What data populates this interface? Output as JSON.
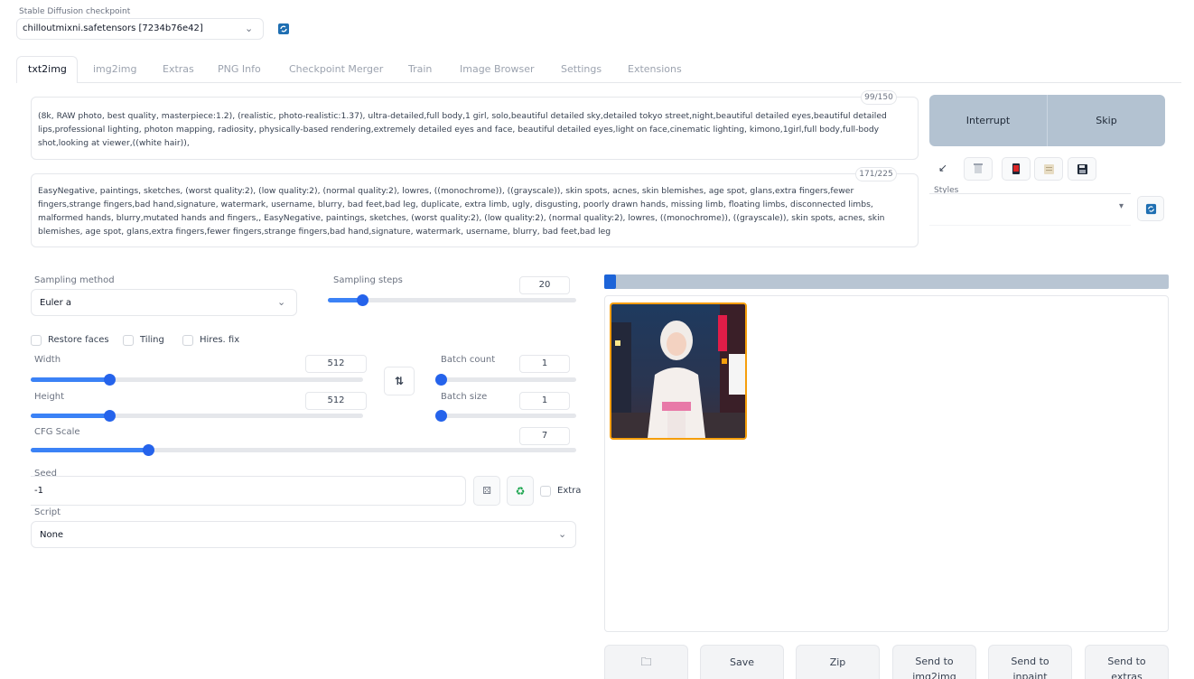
{
  "checkpoint": {
    "label": "Stable Diffusion checkpoint",
    "value": "chilloutmixni.safetensors [7234b76e42]"
  },
  "tabs": [
    "txt2img",
    "img2img",
    "Extras",
    "PNG Info",
    "Checkpoint Merger",
    "Train",
    "Image Browser",
    "Settings",
    "Extensions"
  ],
  "prompt": {
    "counter": "99/150",
    "text": "(8k, RAW photo, best quality, masterpiece:1.2), (realistic, photo-realistic:1.37), ultra-detailed,full body,1 girl, solo,beautiful detailed sky,detailed tokyo street,night,beautiful detailed eyes,beautiful detailed lips,professional lighting, photon mapping, radiosity, physically-based rendering,extremely detailed eyes and face, beautiful detailed eyes,light on face,cinematic lighting, kimono,1girl,full body,full-body shot,looking at viewer,((white hair)),"
  },
  "negative_prompt": {
    "counter": "171/225",
    "text": "EasyNegative, paintings, sketches, (worst quality:2), (low quality:2), (normal quality:2), lowres, ((monochrome)), ((grayscale)), skin spots, acnes, skin blemishes, age spot, glans,extra fingers,fewer fingers,strange fingers,bad hand,signature, watermark, username, blurry, bad feet,bad leg, duplicate, extra limb, ugly, disgusting, poorly drawn hands, missing limb, floating limbs, disconnected limbs, malformed hands, blurry,mutated hands and fingers,, EasyNegative, paintings, sketches, (worst quality:2), (low quality:2), (normal quality:2), lowres, ((monochrome)), ((grayscale)), skin spots, acnes, skin blemishes, age spot, glans,extra fingers,fewer fingers,strange fingers,bad hand,signature, watermark, username, blurry, bad feet,bad leg"
  },
  "actions": {
    "interrupt": "Interrupt",
    "skip": "Skip",
    "styles_label": "Styles"
  },
  "sampling": {
    "method_label": "Sampling method",
    "method_value": "Euler a",
    "steps_label": "Sampling steps",
    "steps_value": "20"
  },
  "checkboxes": {
    "restore_faces": "Restore faces",
    "tiling": "Tiling",
    "hires_fix": "Hires. fix",
    "extra": "Extra"
  },
  "size": {
    "width_label": "Width",
    "width_value": "512",
    "height_label": "Height",
    "height_value": "512"
  },
  "batch": {
    "count_label": "Batch count",
    "count_value": "1",
    "size_label": "Batch size",
    "size_value": "1"
  },
  "cfg": {
    "label": "CFG Scale",
    "value": "7"
  },
  "seed": {
    "label": "Seed",
    "value": "-1"
  },
  "script": {
    "label": "Script",
    "value": "None"
  },
  "output_buttons": {
    "folder": "🗀",
    "save": "Save",
    "zip": "Zip",
    "send_img2img": "Send to img2img",
    "send_inpaint": "Send to inpaint",
    "send_extras": "Send to extras"
  },
  "colors": {
    "accent": "#2563eb",
    "progress_bar": "#b8c5d3",
    "action_button": "#b3c2d1",
    "image_border": "#f59e0b"
  }
}
